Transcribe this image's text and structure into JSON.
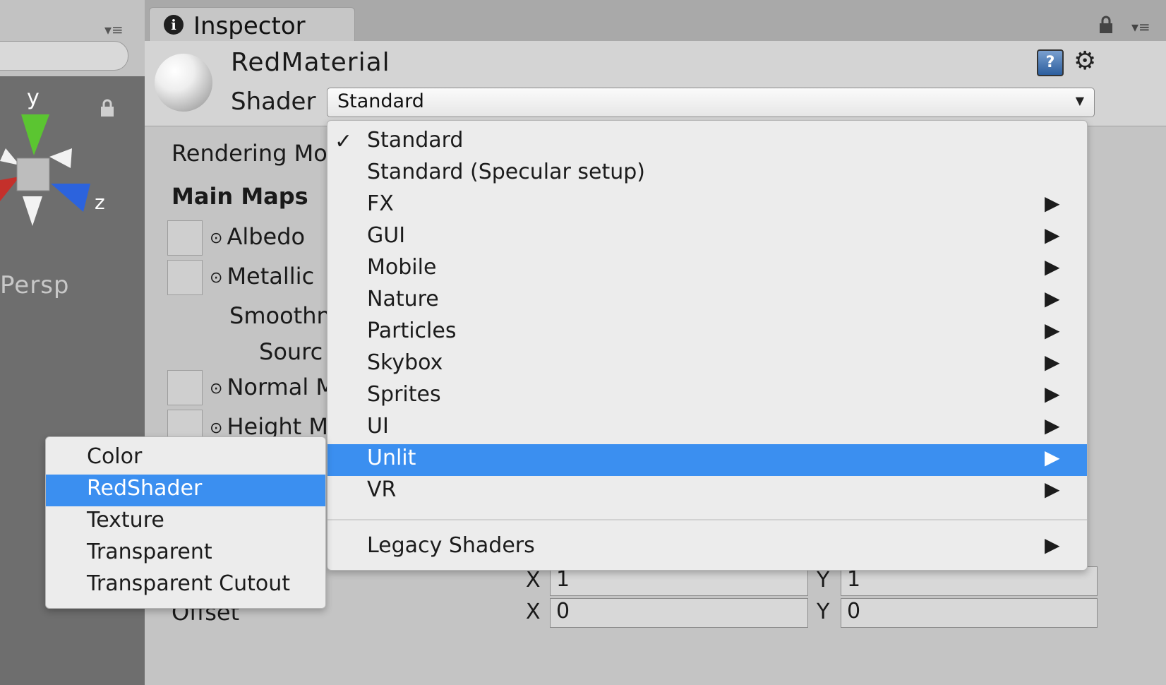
{
  "scene": {
    "axis_y": "y",
    "axis_z": "z",
    "persp_label": "Persp"
  },
  "inspector": {
    "tab_label": "Inspector",
    "material_name": "RedMaterial",
    "shader_label": "Shader",
    "shader_value": "Standard",
    "properties": {
      "rendering_mode": "Rendering Moc",
      "main_maps": "Main Maps",
      "albedo": "Albedo",
      "metallic": "Metallic",
      "smoothness": "Smoothn",
      "source": "Sourc",
      "normal_map": "Normal M",
      "height_map": "Height M",
      "offset": "Offset"
    },
    "tiling": {
      "x_label": "X",
      "x_value": "1",
      "y_label": "Y",
      "y_value": "1"
    },
    "offset": {
      "x_label": "X",
      "x_value": "0",
      "y_label": "Y",
      "y_value": "0"
    }
  },
  "shader_menu": {
    "items": [
      {
        "label": "Standard",
        "checked": true,
        "submenu": false
      },
      {
        "label": "Standard (Specular setup)",
        "checked": false,
        "submenu": false
      },
      {
        "label": "FX",
        "submenu": true
      },
      {
        "label": "GUI",
        "submenu": true
      },
      {
        "label": "Mobile",
        "submenu": true
      },
      {
        "label": "Nature",
        "submenu": true
      },
      {
        "label": "Particles",
        "submenu": true
      },
      {
        "label": "Skybox",
        "submenu": true
      },
      {
        "label": "Sprites",
        "submenu": true
      },
      {
        "label": "UI",
        "submenu": true
      },
      {
        "label": "Unlit",
        "submenu": true,
        "highlighted": true
      },
      {
        "label": "VR",
        "submenu": true
      },
      {
        "label": "Legacy Shaders",
        "submenu": true
      }
    ],
    "checkmark": "✓",
    "submenu_arrow": "▶"
  },
  "unlit_menu": {
    "items": [
      {
        "label": "Color"
      },
      {
        "label": "RedShader",
        "highlighted": true
      },
      {
        "label": "Texture"
      },
      {
        "label": "Transparent"
      },
      {
        "label": "Transparent Cutout"
      }
    ]
  },
  "icons": {
    "info": "i",
    "help": "?",
    "gear": "⚙",
    "dropdown_arrow": "▼",
    "circle_select": "⊙",
    "menu": "▾≡"
  },
  "colors": {
    "highlight": "#3b8ff0",
    "panel_bg": "#c4c4c4",
    "menu_bg": "#ececec",
    "axis_x": "#c4302b",
    "axis_y": "#5bc531",
    "axis_z": "#2c63dd"
  }
}
